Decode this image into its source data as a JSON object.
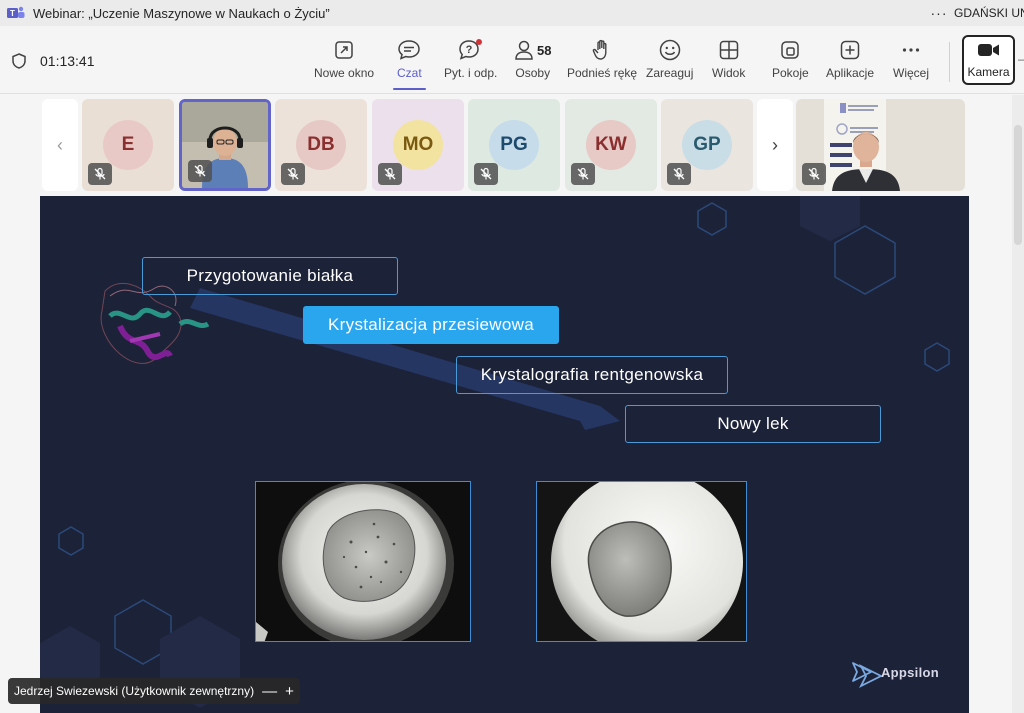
{
  "window": {
    "title": "Webinar: „Uczenie Maszynowe w Naukach o Życiu”",
    "more": "···",
    "org": "GDAŃSKI UNIWERSYTET"
  },
  "meeting": {
    "timer": "01:13:41"
  },
  "toolbar": {
    "new_window": "Nowe okno",
    "chat": "Czat",
    "qa": "Pyt. i odp.",
    "people": "Osoby",
    "people_count": "58",
    "raise_hand": "Podnieś rękę",
    "react": "Zareaguj",
    "view": "Widok",
    "rooms": "Pokoje",
    "apps": "Aplikacje",
    "more": "Więcej",
    "camera": "Kamera"
  },
  "participants": [
    {
      "initials": "E",
      "bg": "#e8c9c5",
      "fg": "#8a3030",
      "tile": "#eadfd5"
    },
    {
      "initials": "DB",
      "bg": "#e6c8c4",
      "fg": "#8a2e2e",
      "tile": "#ece2da"
    },
    {
      "initials": "MO",
      "bg": "#f3e3a0",
      "fg": "#7a5a10",
      "tile": "#ebe0ec"
    },
    {
      "initials": "PG",
      "bg": "#c6dcea",
      "fg": "#1e4a6e",
      "tile": "#dde9e1"
    },
    {
      "initials": "KW",
      "bg": "#e7c9c6",
      "fg": "#8a2e2e",
      "tile": "#e3e9e3"
    },
    {
      "initials": "GP",
      "bg": "#c9dde6",
      "fg": "#2a5a6e",
      "tile": "#ebe5e0"
    }
  ],
  "slide": {
    "steps": [
      "Przygotowanie białka",
      "Krystalizacja przesiewowa",
      "Krystalografia rentgenowska",
      "Nowy lek"
    ],
    "brand": "Appsilon"
  },
  "presenter": {
    "name": "Jedrzej Swiezewski (Użytkownik zewnętrzny)",
    "zoom_out": "—",
    "zoom_in": "+"
  },
  "colors": {
    "accent": "#5b5fc7",
    "slide_bg": "#1c2238",
    "highlight": "#2aa6ef"
  }
}
